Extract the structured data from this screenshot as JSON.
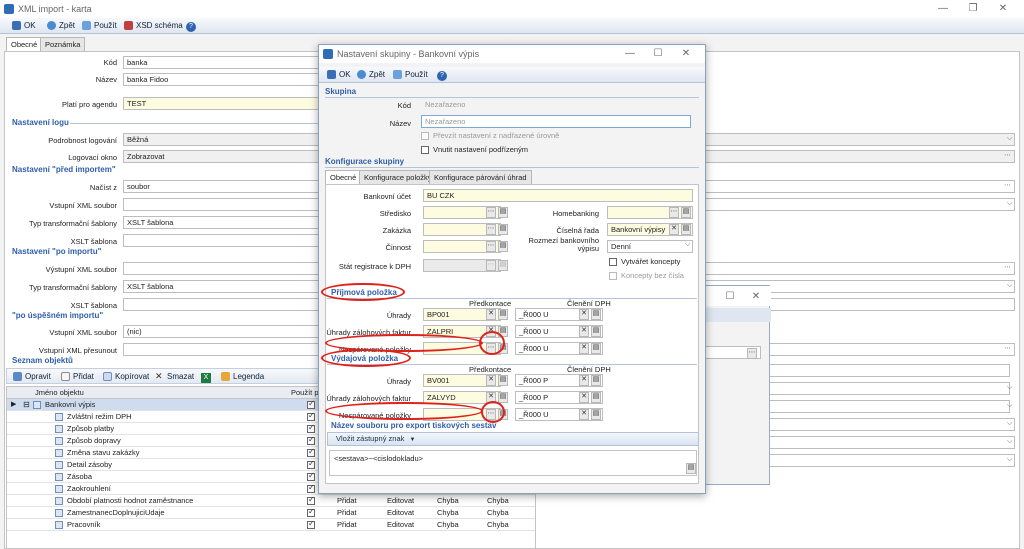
{
  "main": {
    "title": "XML import - karta",
    "toolbar": {
      "ok": "OK",
      "back": "Zpět",
      "apply": "Použít",
      "xsd": "XSD schéma"
    },
    "tabs": [
      "Obecné",
      "Poznámka"
    ],
    "fields": {
      "kod_label": "Kód",
      "kod": "banka",
      "nazev_label": "Název",
      "nazev": "banka Fidoo",
      "plati_label": "Platí pro agendu",
      "plati": "TEST"
    },
    "sec_logu": "Nastavení logu",
    "podrobnost_label": "Podrobnost logování",
    "podrobnost": "Běžná",
    "okno_label": "Logovací okno",
    "okno": "Zobrazovat",
    "sec_pred": "Nastavení \"před importem\"",
    "nacist_label": "Načíst z",
    "nacist": "soubor",
    "vstupni_label": "Vstupní XML soubor",
    "typ_label": "Typ transformační šablony",
    "typ": "XSLT šablona",
    "xslt_label": "XSLT šablona",
    "sec_po": "Nastavení \"po importu\"",
    "vystupni_label": "Výstupní XML soubor",
    "typ2_label": "Typ transformační šablony",
    "typ2": "XSLT šablona",
    "xslt2_label": "XSLT šablona",
    "sec_uspesnem": "\"po úspěšném importu\"",
    "vstupni2_label": "Vstupní XML soubor",
    "vstupni2": "(nic)",
    "presunout_label": "Vstupní XML přesunout",
    "sec_seznam": "Seznam objektů",
    "grid_toolbar": {
      "opravit": "Opravit",
      "pridat": "Přidat",
      "kopirovat": "Kopírovat",
      "smazat": "Smazat",
      "x": "X",
      "legenda": "Legenda"
    },
    "grid_headers": {
      "jmeno": "Jméno objektu",
      "pouzit": "Použít pr"
    },
    "grid_rows": [
      {
        "name": "Bankovní výpis",
        "root": true,
        "a": "",
        "b": "",
        "c": "",
        "d": ""
      },
      {
        "name": "Zvláštní režim DPH",
        "a": "",
        "b": "",
        "c": "",
        "d": ""
      },
      {
        "name": "Způsob platby",
        "a": "",
        "b": "",
        "c": "",
        "d": ""
      },
      {
        "name": "Způsob dopravy",
        "a": "",
        "b": "",
        "c": "",
        "d": ""
      },
      {
        "name": "Změna stavu zakázky",
        "a": "",
        "b": "",
        "c": "",
        "d": ""
      },
      {
        "name": "Detail zásoby",
        "a": "",
        "b": "",
        "c": "",
        "d": ""
      },
      {
        "name": "Zásoba",
        "a": "",
        "b": "",
        "c": "",
        "d": ""
      },
      {
        "name": "Zaokrouhlení",
        "a": "",
        "b": "",
        "c": "",
        "d": ""
      },
      {
        "name": "Období platnosti hodnot zaměstnance",
        "a": "Přidat",
        "b": "Editovat",
        "c": "Chyba",
        "d": "Chyba"
      },
      {
        "name": "ZamestnanecDoplnujiciUdaje",
        "a": "Přidat",
        "b": "Editovat",
        "c": "Chyba",
        "d": "Chyba"
      },
      {
        "name": "Pracovník",
        "a": "Přidat",
        "b": "Editovat",
        "c": "Chyba",
        "d": "Chyba"
      }
    ]
  },
  "dialog": {
    "title": "Nastavení skupiny - Bankovní výpis",
    "toolbar": {
      "ok": "OK",
      "back": "Zpět",
      "apply": "Použít"
    },
    "sec_skupina": "Skupina",
    "kod_label": "Kód",
    "kod": "Nezařazeno",
    "nazev_label": "Název",
    "nazev": "Nezařazeno",
    "prevzit": "Převzít nastavení z nadřazené úrovně",
    "vnutit": "Vnutit nastavení podřízeným",
    "sec_konfigurace": "Konfigurace skupiny",
    "tabs": [
      "Obecné",
      "Konfigurace položky",
      "Konfigurace párování úhrad"
    ],
    "ucet_label": "Bankovní účet",
    "ucet": "BU CZK",
    "stredisko_label": "Středisko",
    "zakazka_label": "Zakázka",
    "cinnost_label": "Činnost",
    "stat_label": "Stát registrace k DPH",
    "homebanking_label": "Homebanking",
    "rada_label": "Číselná řada",
    "rada": "Bankovní výpisy",
    "rozmezi_label": "Rozmezí bankovního výpisu",
    "rozmezi": "Denní",
    "vytvaret": "Vytvářet koncepty",
    "koncepty": "Koncepty bez čísla",
    "sec_prijmova": "Příjmová položka",
    "predkontace": "Předkontace",
    "cleneni": "Členění DPH",
    "prij_rows": [
      {
        "label": "Úhrady",
        "pk": "BP001",
        "dph": "_Ř000 U"
      },
      {
        "label": "Úhrady zálohových faktur",
        "pk": "ZALPRI",
        "dph": "_Ř000 U"
      },
      {
        "label": "Nespárované položky",
        "pk": "",
        "dph": "_Ř000 U"
      }
    ],
    "sec_vydajova": "Výdajová položka",
    "predkontace2": "Předkontace",
    "cleneni2": "Členění DPH",
    "vyd_rows": [
      {
        "label": "Úhrady",
        "pk": "BV001",
        "dph": "_Ř000 P"
      },
      {
        "label": "Úhrady zálohových faktur",
        "pk": "ZALVYD",
        "dph": "_Ř000 P"
      },
      {
        "label": "Nespárované položky",
        "pk": "",
        "dph": "_Ř000 U"
      }
    ],
    "sec_export": "Název souboru pro export tiskových sestav",
    "vlozit": "Vložit zástupný znak",
    "vzor": "<sestava>~<cislodokladu>"
  }
}
